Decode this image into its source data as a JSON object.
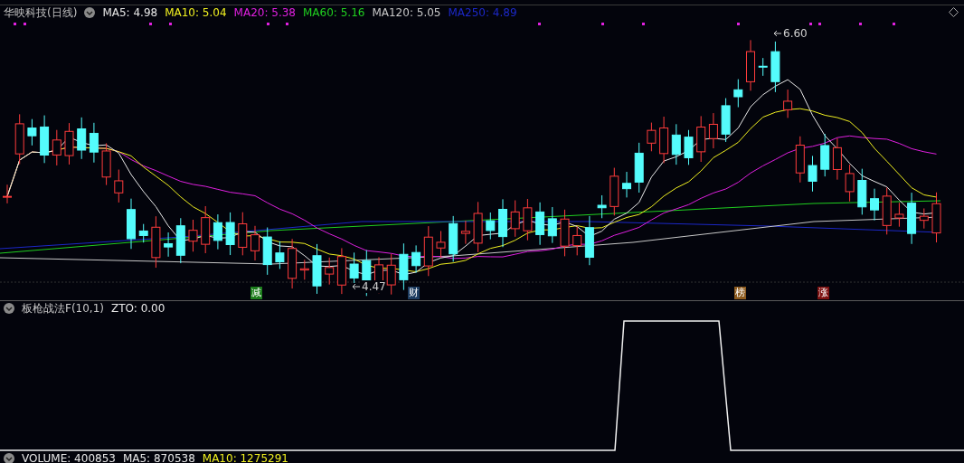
{
  "chart_title": "华映科技(日线)",
  "ma_legend": [
    {
      "label": "MA5: 4.98",
      "color": "#e8e8e8"
    },
    {
      "label": "MA10: 5.04",
      "color": "#f0f020"
    },
    {
      "label": "MA20: 5.38",
      "color": "#e020e0"
    },
    {
      "label": "MA60: 5.16",
      "color": "#20d020"
    },
    {
      "label": "MA120: 5.05",
      "color": "#c8c8c8"
    },
    {
      "label": "MA250: 4.89",
      "color": "#1c28c8"
    }
  ],
  "price_labels": [
    {
      "text": "6.60"
    },
    {
      "text": "4.47"
    }
  ],
  "event_markers": [
    {
      "label": "减",
      "color": "#1b7d1b"
    },
    {
      "label": "财",
      "color": "#1d3c60"
    },
    {
      "label": "榜",
      "color": "#8c5a1e"
    },
    {
      "label": "涨",
      "color": "#7c1010"
    }
  ],
  "indicator_legend": [
    {
      "label": "板枪战法F(10,1)",
      "color": "#c8c8c8"
    },
    {
      "label": "ZTO: 0.00",
      "color": "#e8e8e8"
    }
  ],
  "volume_legend": [
    {
      "label": "VOLUME: 400853",
      "color": "#e8e8e8"
    },
    {
      "label": "MA5: 870538",
      "color": "#e8e8e8"
    },
    {
      "label": "MA10: 1275291",
      "color": "#f0f020"
    }
  ]
}
